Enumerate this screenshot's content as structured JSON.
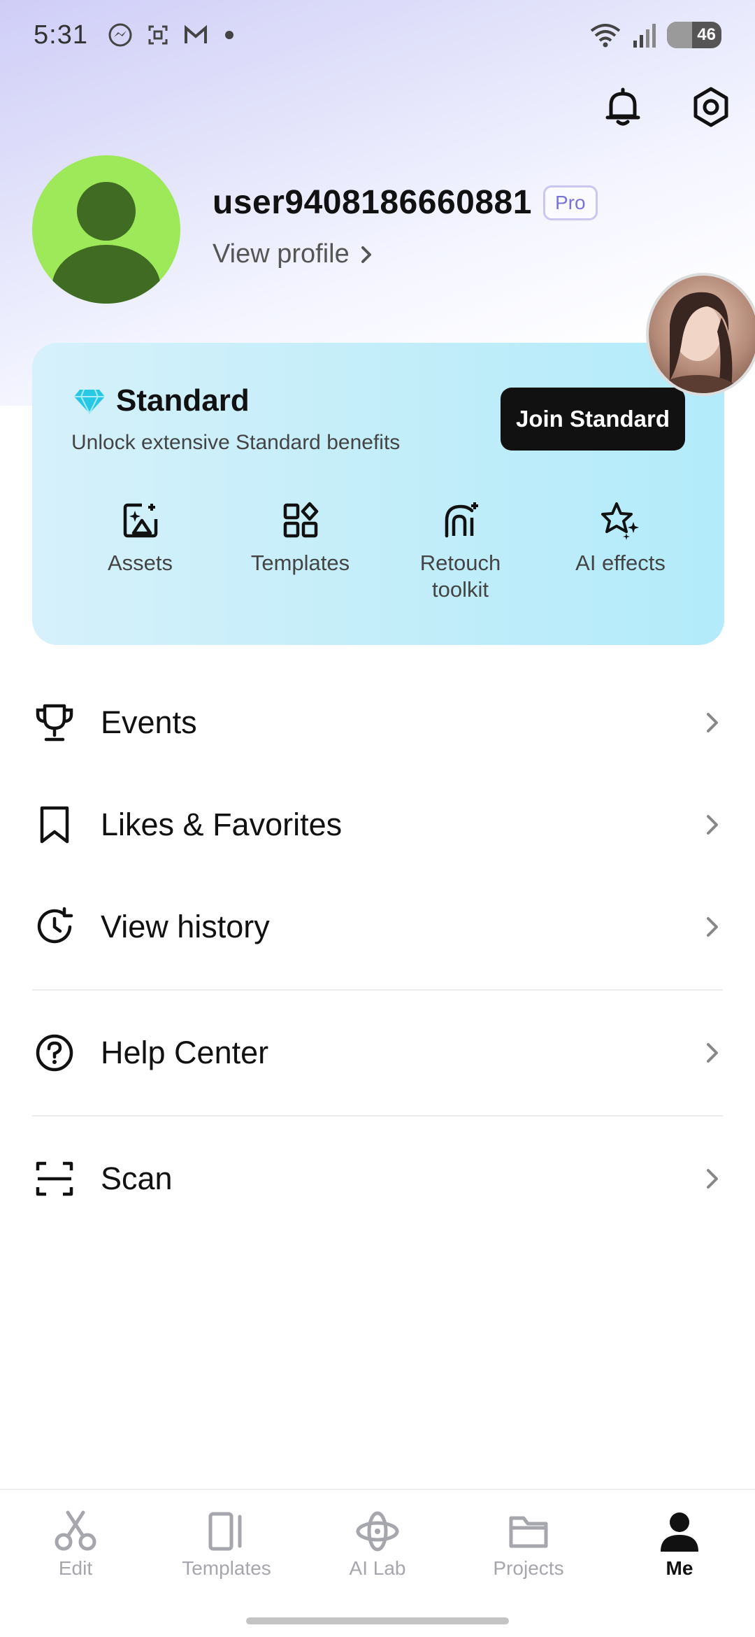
{
  "status_bar": {
    "time": "5:31",
    "battery": "46",
    "icons": [
      "messenger-icon",
      "screenshot-icon",
      "gmail-icon",
      "wifi-icon",
      "signal-icon",
      "battery-icon"
    ]
  },
  "header": {
    "actions": [
      "bell-icon",
      "settings-icon"
    ]
  },
  "profile": {
    "username": "user9408186660881",
    "badge": "Pro",
    "view_profile": "View profile"
  },
  "standard_card": {
    "title": "Standard",
    "subtitle": "Unlock extensive Standard benefits",
    "button": "Join Standard",
    "benefits": [
      {
        "label": "Assets",
        "icon": "image-sparkle-icon"
      },
      {
        "label": "Templates",
        "icon": "grid-icon"
      },
      {
        "label": "Retouch\ntoolkit",
        "icon": "retouch-icon"
      },
      {
        "label": "AI effects",
        "icon": "stars-icon"
      }
    ]
  },
  "menu": [
    {
      "label": "Events",
      "icon": "trophy-icon"
    },
    {
      "label": "Likes & Favorites",
      "icon": "bookmark-icon"
    },
    {
      "label": "View history",
      "icon": "history-icon"
    },
    {
      "label": "Help Center",
      "icon": "help-icon"
    },
    {
      "label": "Scan",
      "icon": "scan-icon"
    }
  ],
  "bottom_nav": [
    {
      "label": "Edit",
      "icon": "scissors-icon",
      "active": false
    },
    {
      "label": "Templates",
      "icon": "template-icon",
      "active": false
    },
    {
      "label": "AI Lab",
      "icon": "ai-lab-icon",
      "active": false
    },
    {
      "label": "Projects",
      "icon": "folder-icon",
      "active": false
    },
    {
      "label": "Me",
      "icon": "person-icon",
      "active": true
    }
  ],
  "colors": {
    "accent_pro": "#7a74d6",
    "card_bg": "#c5eef9",
    "avatar_bg": "#9de95a",
    "diamond": "#29c7e6"
  }
}
